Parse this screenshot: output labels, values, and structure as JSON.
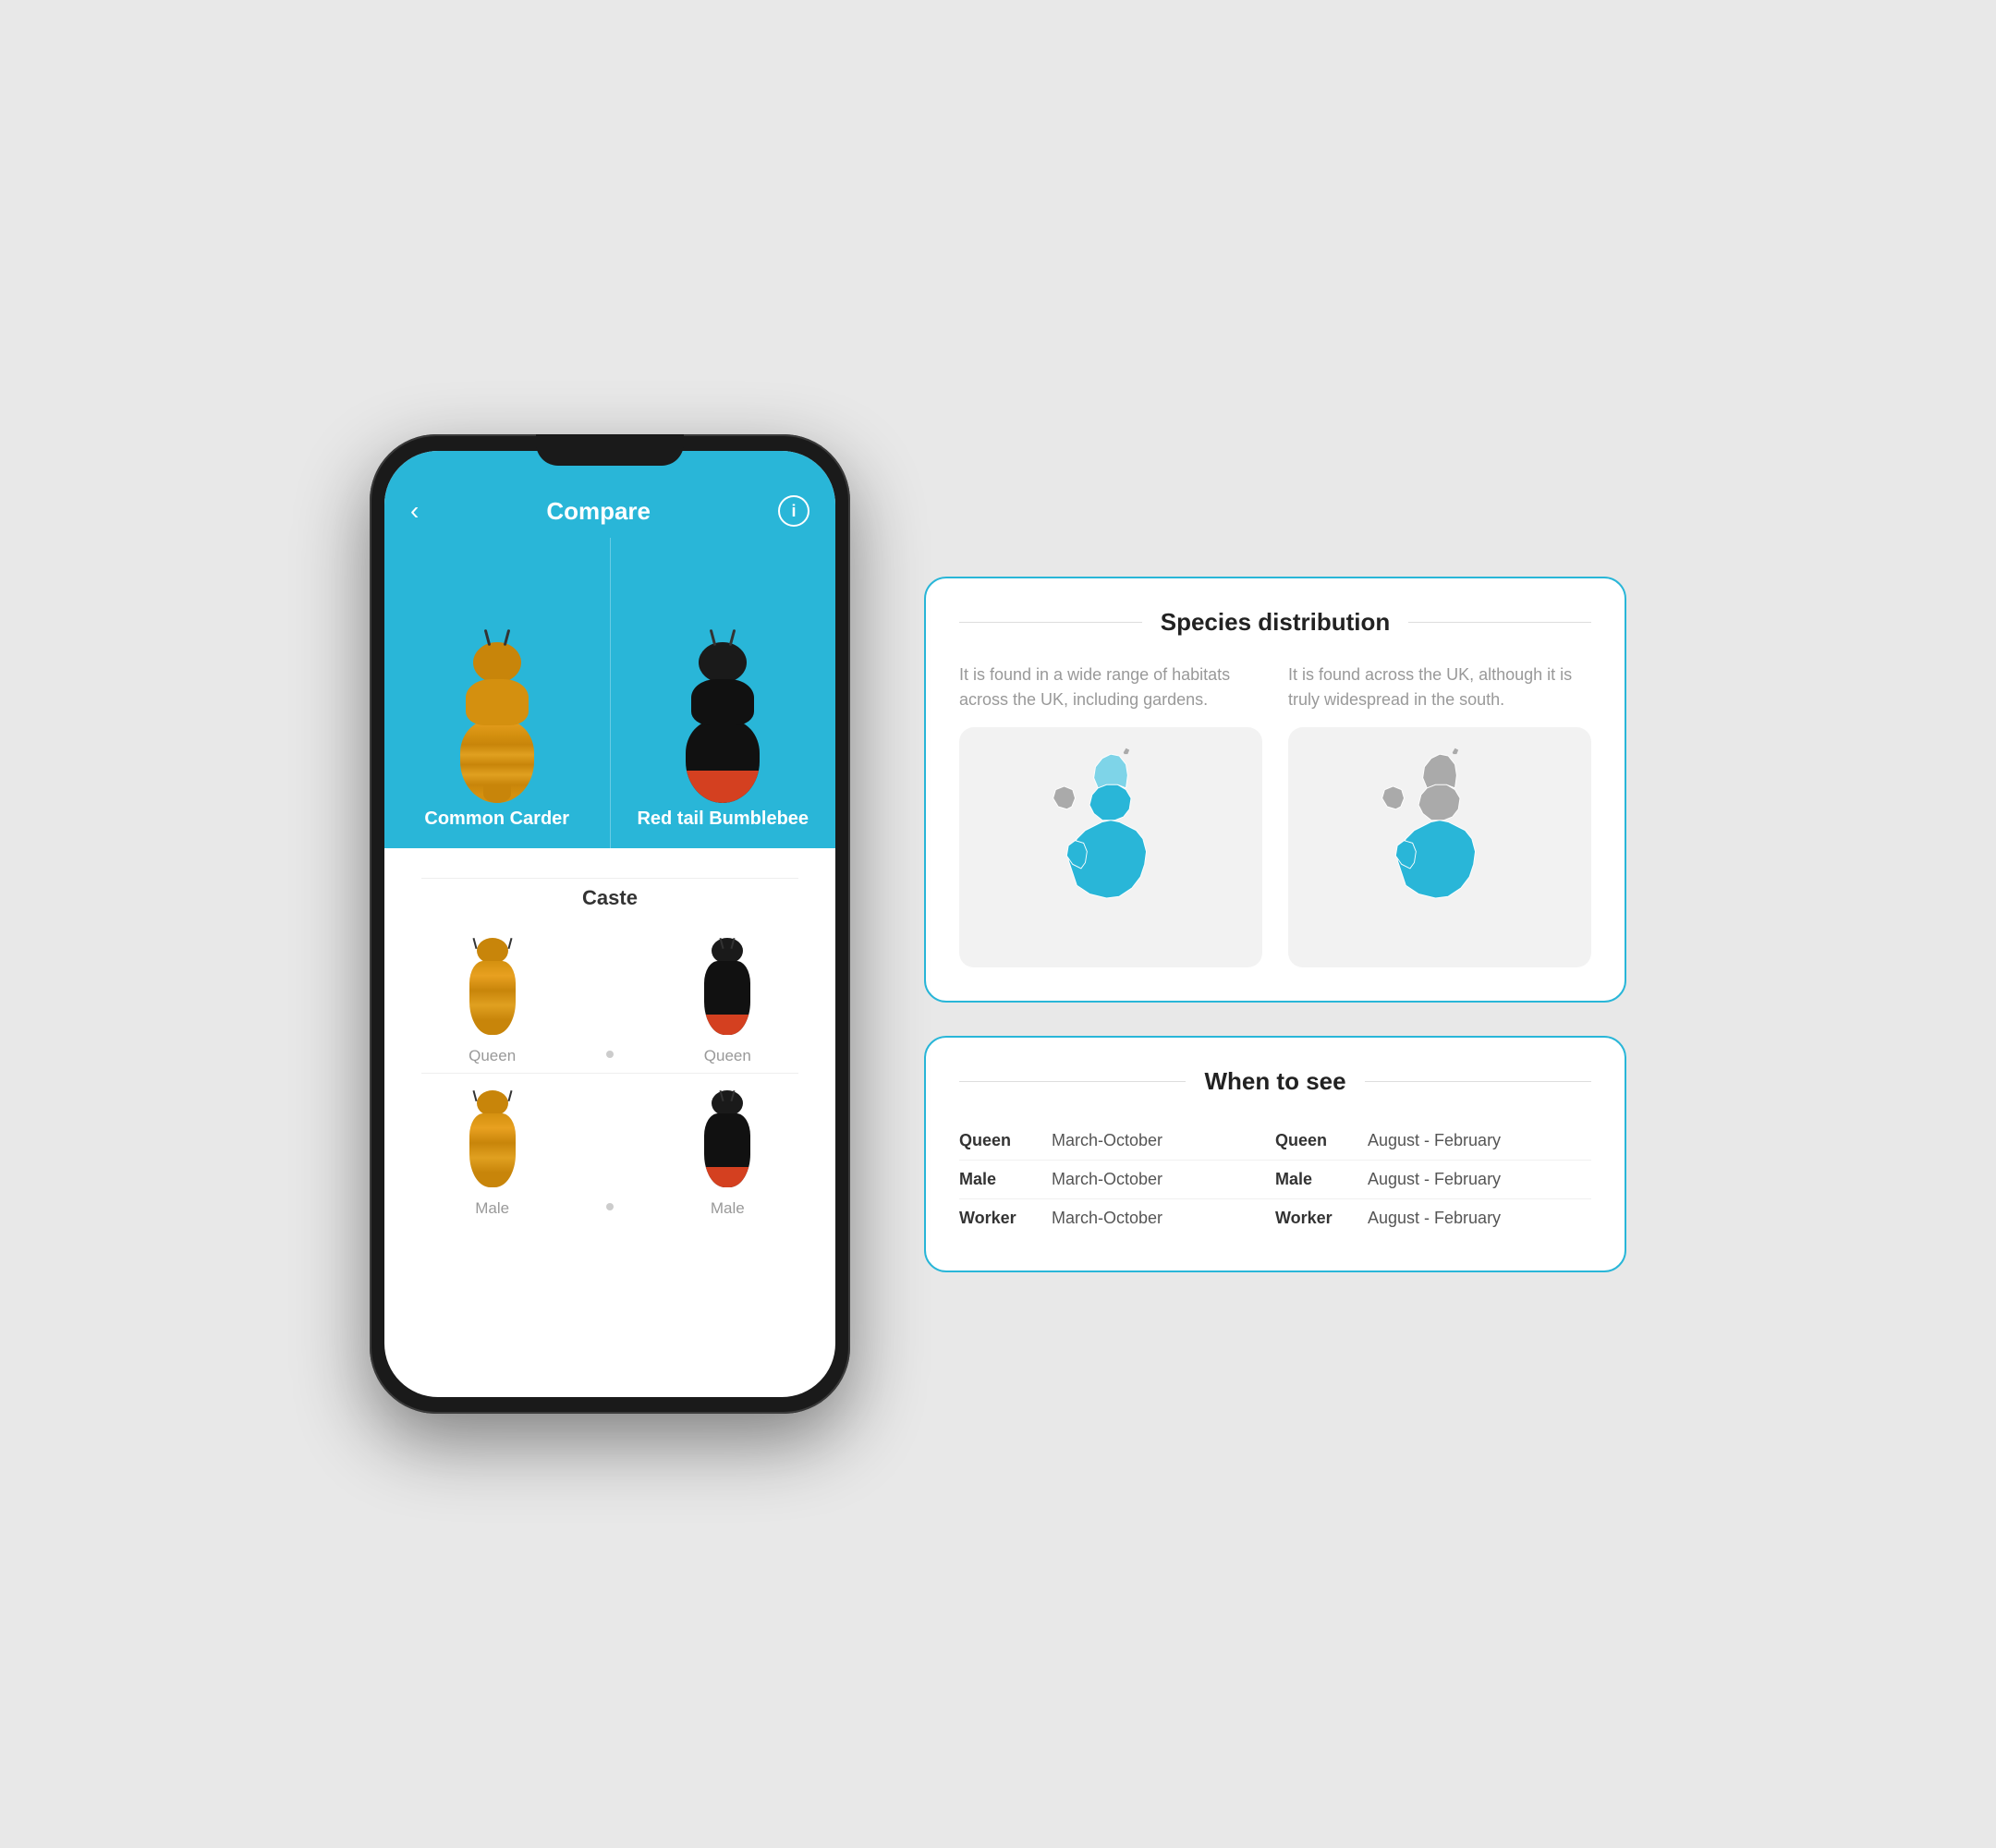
{
  "phone": {
    "header": {
      "back_label": "‹",
      "title": "Compare",
      "info_label": "i"
    },
    "bee1": {
      "name": "Common Carder"
    },
    "bee2": {
      "name": "Red tail Bumblebee"
    },
    "caste_section": {
      "title": "Caste",
      "rows": [
        {
          "label1": "Queen",
          "label2": "Queen"
        },
        {
          "label1": "Male",
          "label2": "Male"
        }
      ]
    }
  },
  "distribution_card": {
    "title": "Species distribution",
    "col1_text": "It is found in a wide range of habitats across the UK, including gardens.",
    "col2_text": "It is found across the UK, although it is truly widespread in the south."
  },
  "when_card": {
    "title": "When to see",
    "col1": {
      "rows": [
        {
          "caste": "Queen",
          "dates": "March-October"
        },
        {
          "caste": "Male",
          "dates": "March-October"
        },
        {
          "caste": "Worker",
          "dates": "March-October"
        }
      ]
    },
    "col2": {
      "rows": [
        {
          "caste": "Queen",
          "dates": "August - February"
        },
        {
          "caste": "Male",
          "dates": "August - February"
        },
        {
          "caste": "Worker",
          "dates": "August - February"
        }
      ]
    }
  },
  "colors": {
    "accent": "#29b6d8",
    "orange": "#c8850a",
    "dark": "#1a1a1a",
    "red": "#d44020"
  }
}
